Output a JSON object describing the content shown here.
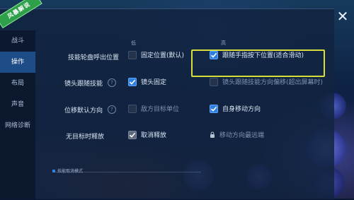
{
  "badge": "风暴解说",
  "hud": {
    "left": "",
    "right": [
      "",
      ""
    ]
  },
  "sidebar": {
    "items": [
      {
        "label": "战斗",
        "active": false
      },
      {
        "label": "操作",
        "active": true
      },
      {
        "label": "布局",
        "active": false
      },
      {
        "label": "声音",
        "active": false
      },
      {
        "label": "网络诊断",
        "active": false
      }
    ]
  },
  "columns": {
    "low": "低",
    "high": "高"
  },
  "rows": [
    {
      "label": "技能轮盘呼出位置",
      "options": [
        {
          "label": "固定位置(默认)",
          "checked": false,
          "dim": false
        },
        {
          "label": "跟随手指按下位置(适合滑动)",
          "checked": true,
          "dim": false
        }
      ]
    },
    {
      "label": "镜头跟随技能",
      "options": [
        {
          "label": "镜头固定",
          "checked": true,
          "dim": false
        },
        {
          "label": "镜头跟随技能方向偏移(超出屏幕时)",
          "checked": false,
          "dim": true
        }
      ]
    },
    {
      "label": "位移默认方向",
      "options": [
        {
          "label": "敌方目标单位",
          "checked": false,
          "dim": true
        },
        {
          "label": "自身移动方向",
          "checked": true,
          "dim": false
        }
      ]
    },
    {
      "label": "无目标时释放",
      "options": [
        {
          "label": "取消释放",
          "checked": true,
          "dim": false
        },
        {
          "label": "移动方向最远端",
          "checked": false,
          "dim": true,
          "locked": true
        }
      ]
    }
  ],
  "footer": {
    "tip": "技能取消模式"
  },
  "close": {
    "symbol": "✕"
  },
  "colors": {
    "accent": "#2e7fe0",
    "highlight": "#d7dd3c",
    "badge": "#2fa04a"
  }
}
